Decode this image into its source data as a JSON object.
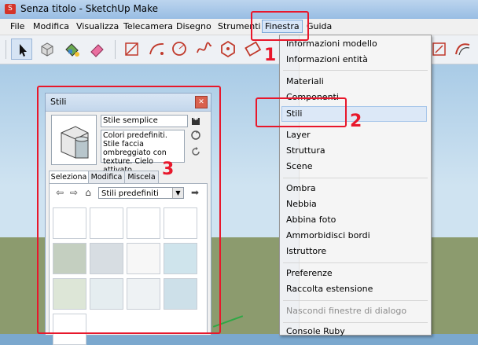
{
  "window": {
    "title": "Senza titolo - SketchUp Make"
  },
  "menubar": [
    "File",
    "Modifica",
    "Visualizza",
    "Telecamera",
    "Disegno",
    "Strumenti",
    "Finestra",
    "Guida"
  ],
  "toolbar_icons": [
    "select-icon",
    "component-icon",
    "paint-bucket-icon",
    "eraser-icon",
    "line-icon",
    "arc-icon",
    "freehand-icon",
    "polygon-icon",
    "rectangle-icon"
  ],
  "finestra_menu": {
    "groups": [
      [
        "Informazioni modello",
        "Informazioni entità"
      ],
      [
        "Materiali",
        "Componenti",
        "Stili",
        "Layer",
        "Struttura",
        "Scene"
      ],
      [
        "Ombra",
        "Nebbia",
        "Abbina foto",
        "Ammorbidisci bordi",
        "Istruttore"
      ],
      [
        "Preferenze",
        "Raccolta estensione"
      ],
      [
        "Nascondi finestre di dialogo"
      ],
      [
        "Console Ruby"
      ]
    ],
    "highlighted": "Stili",
    "disabled": "Nascondi finestre di dialogo"
  },
  "stili_panel": {
    "title": "Stili",
    "style_name": "Stile semplice",
    "description": "Colori predefiniti. Stile faccia ombreggiato con texture. Cielo attivato.",
    "tabs": [
      "Seleziona",
      "Modifica",
      "Miscela"
    ],
    "active_tab": "Seleziona",
    "library": "Stili predefiniti",
    "thumbnail_count": 13
  },
  "annotations": [
    "1",
    "2",
    "3"
  ],
  "colors": {
    "annotation": "#e8172b",
    "sky": "#cfe3f1",
    "ground": "#8c9b6e"
  }
}
